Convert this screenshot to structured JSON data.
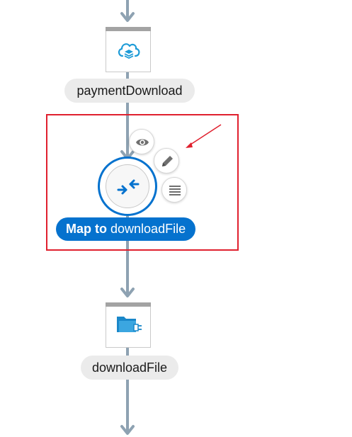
{
  "flow": {
    "nodes": [
      {
        "id": "paymentDownload",
        "label": "paymentDownload",
        "icon": "cloud-layers-icon"
      },
      {
        "id": "map",
        "label_prefix": "Map to",
        "label_target": "downloadFile",
        "icon": "map-arrows-icon"
      },
      {
        "id": "downloadFile",
        "label": "downloadFile",
        "icon": "folder-plug-icon"
      }
    ],
    "map_actions": [
      {
        "name": "view-button",
        "icon": "eye-icon"
      },
      {
        "name": "edit-button",
        "icon": "pencil-icon"
      },
      {
        "name": "details-button",
        "icon": "lines-icon"
      }
    ]
  },
  "colors": {
    "accent": "#0572ce",
    "connector": "#8ea2b2",
    "highlight": "#e0202e",
    "node_bar": "#a3a3a3",
    "pill_bg": "#ebebeb"
  }
}
